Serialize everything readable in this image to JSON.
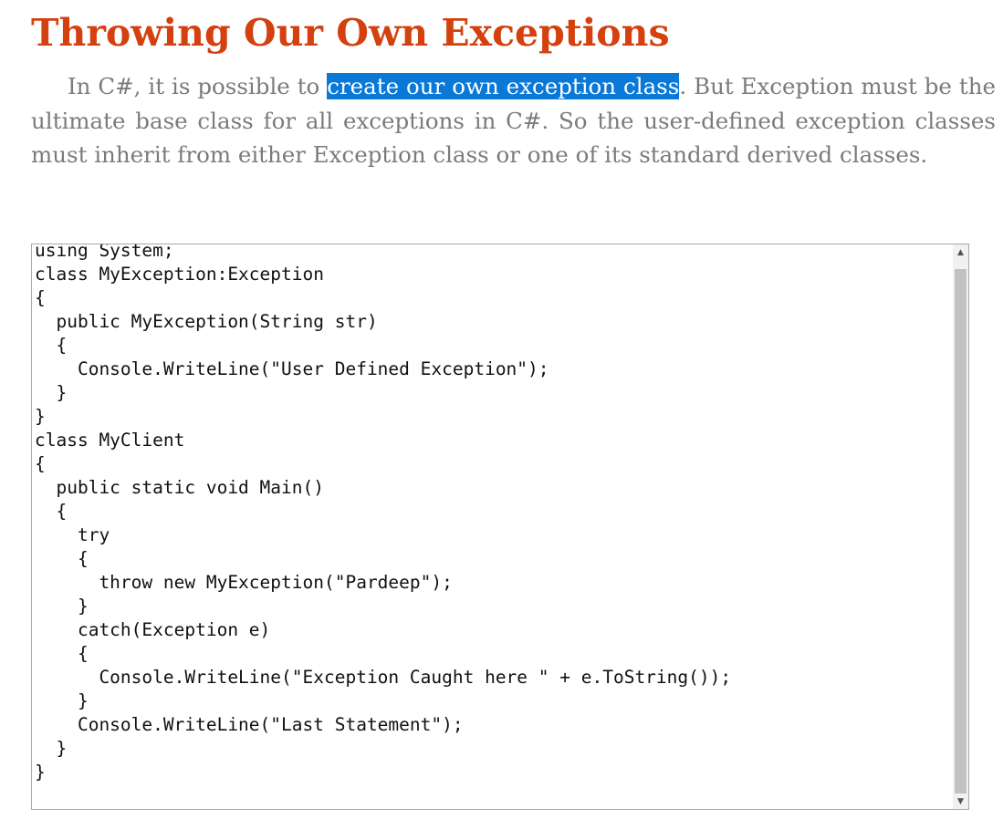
{
  "article": {
    "heading": "Throwing Our Own Exceptions",
    "paragraph": {
      "before_selection": "In C#, it is possible to ",
      "selected": "create our own exception class",
      "after_selection": ". But Exception must be the ultimate base class for all exceptions in C#. So the user-defined exception classes must inherit from either Exception class or one of its standard derived classes."
    }
  },
  "code_block": {
    "lines": [
      "using System;",
      "class MyException:Exception",
      "{",
      "  public MyException(String str)",
      "  {",
      "    Console.WriteLine(\"User Defined Exception\");",
      "  }",
      "}",
      "class MyClient",
      "{",
      "  public static void Main()",
      "  {",
      "    try",
      "    {",
      "      throw new MyException(\"Pardeep\");",
      "    }",
      "    catch(Exception e)",
      "    {",
      "      Console.WriteLine(\"Exception Caught here \" + e.ToString());",
      "    }",
      "    Console.WriteLine(\"Last Statement\");",
      "  }",
      "}"
    ],
    "scrollbar": {
      "up_icon": "chevron-up-icon",
      "down_icon": "chevron-down-icon"
    }
  },
  "colors": {
    "heading": "#d4400e",
    "body_text": "#7b7b7b",
    "selection_bg": "#0a78d7",
    "selection_text": "#ffffff",
    "code_text": "#111111"
  }
}
